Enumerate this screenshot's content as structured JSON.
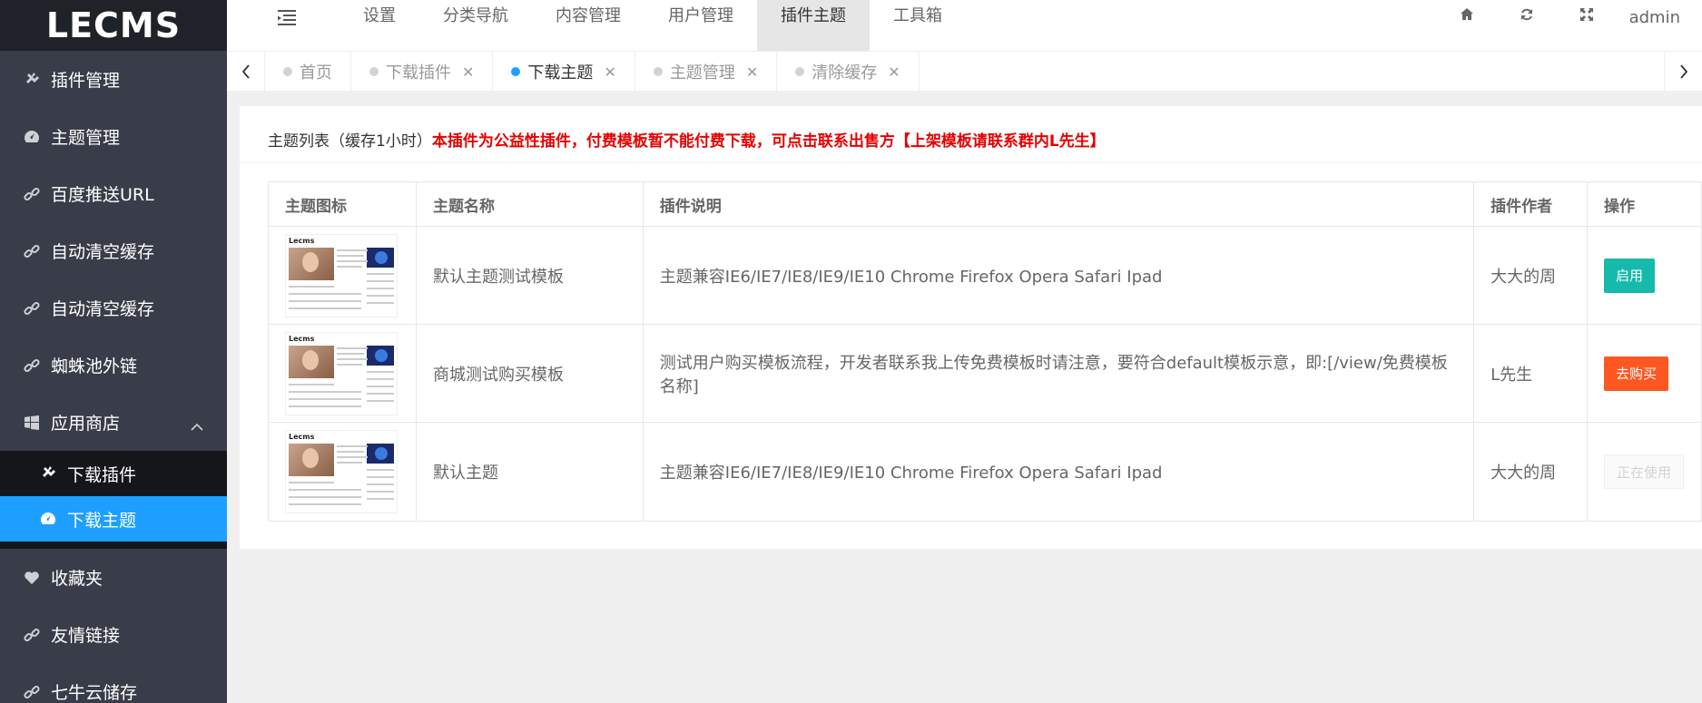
{
  "app": {
    "logo": "LECMS"
  },
  "sidebar": {
    "items": [
      {
        "label": "插件管理",
        "icon": "plug-icon"
      },
      {
        "label": "主题管理",
        "icon": "dashboard-icon"
      },
      {
        "label": "百度推送URL",
        "icon": "link-icon"
      },
      {
        "label": "自动清空缓存",
        "icon": "link-icon"
      },
      {
        "label": "自动清空缓存",
        "icon": "link-icon"
      },
      {
        "label": "蜘蛛池外链",
        "icon": "link-icon"
      },
      {
        "label": "应用商店",
        "icon": "windows-icon"
      }
    ],
    "submenu": [
      {
        "label": "下载插件",
        "icon": "plug-icon"
      },
      {
        "label": "下载主题",
        "icon": "dashboard-icon"
      }
    ],
    "items_after": [
      {
        "label": "收藏夹",
        "icon": "heart-icon"
      },
      {
        "label": "友情链接",
        "icon": "link-icon"
      },
      {
        "label": "七牛云储存",
        "icon": "link-icon"
      }
    ]
  },
  "topnav": {
    "items": [
      "设置",
      "分类导航",
      "内容管理",
      "用户管理",
      "插件主题",
      "工具箱"
    ],
    "active": "插件主题",
    "user": "admin"
  },
  "tabs": [
    {
      "label": "首页",
      "closable": false
    },
    {
      "label": "下载插件",
      "closable": true
    },
    {
      "label": "下载主题",
      "closable": true,
      "active": true
    },
    {
      "label": "主题管理",
      "closable": true
    },
    {
      "label": "清除缓存",
      "closable": true
    }
  ],
  "card": {
    "title": "主题列表（缓存1小时）",
    "notice": "本插件为公益性插件，付费模板暂不能付费下载，可点击联系出售方【上架模板请联系群内L先生】"
  },
  "table": {
    "headers": [
      "主题图标",
      "主题名称",
      "插件说明",
      "插件作者",
      "操作"
    ],
    "rows": [
      {
        "name": "默认主题测试模板",
        "desc": "主题兼容IE6/IE7/IE8/IE9/IE10 Chrome Firefox Opera Safari Ipad",
        "author": "大大的周",
        "action": "启用",
        "action_style": "green"
      },
      {
        "name": "商城测试购买模板",
        "desc": "测试用户购买模板流程，开发者联系我上传免费模板时请注意，要符合default模板示意，即:[/view/免费模板名称]",
        "author": "L先生",
        "action": "去购买",
        "action_style": "orange"
      },
      {
        "name": "默认主题",
        "desc": "主题兼容IE6/IE7/IE8/IE9/IE10 Chrome Firefox Opera Safari Ipad",
        "author": "大大的周",
        "action": "正在使用",
        "action_style": "disabled"
      }
    ],
    "thumb_logo": "Lecms"
  }
}
